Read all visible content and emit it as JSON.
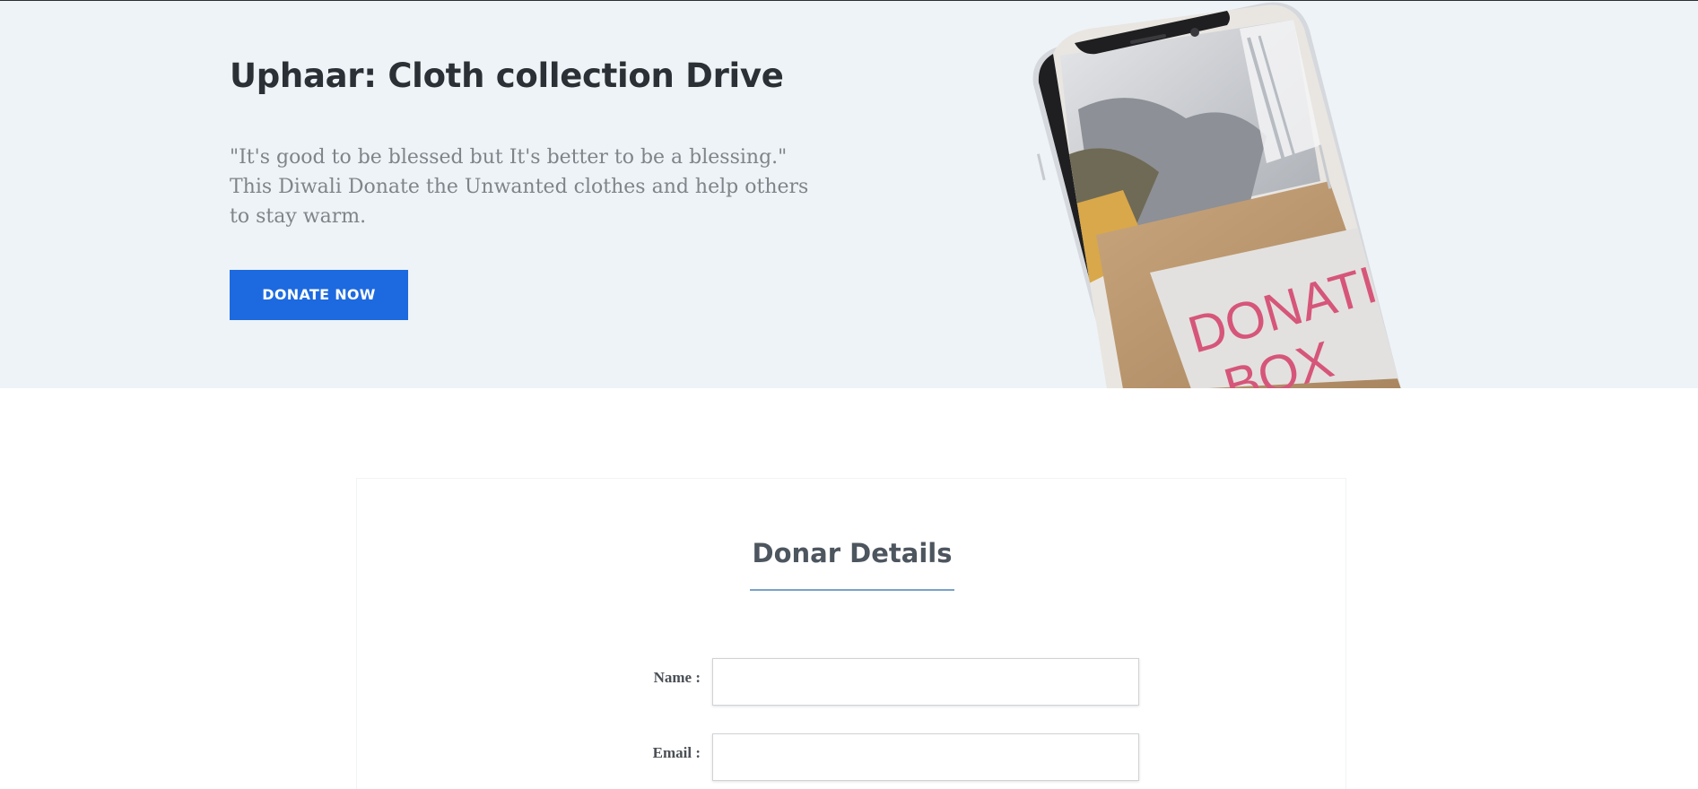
{
  "hero": {
    "title": "Uphaar: Cloth collection Drive",
    "quote_line1": "\"It's good to be blessed but It's better to be a blessing.\"",
    "quote_line2": "This Diwali Donate the Unwanted clothes and help others",
    "quote_line3": "to stay warm.",
    "donate_button": "DONATE NOW",
    "image_icon": "phone-donation-box-image",
    "box_text": "DONATIO",
    "box_text2": "BOX"
  },
  "form": {
    "title": "Donar Details",
    "fields": [
      {
        "label": "Name :",
        "value": "",
        "placeholder": ""
      },
      {
        "label": "Email :",
        "value": "",
        "placeholder": ""
      }
    ]
  },
  "colors": {
    "hero_bg": "#eef3f7",
    "button": "#1d6ae0",
    "underline": "#7aa2c8"
  }
}
